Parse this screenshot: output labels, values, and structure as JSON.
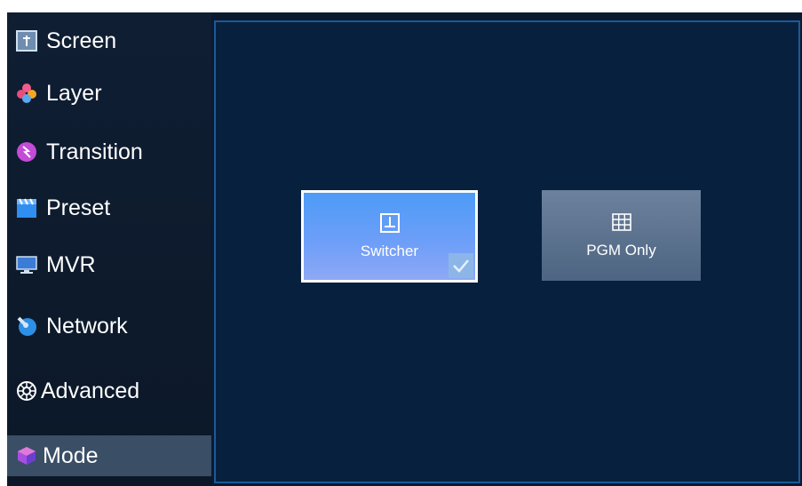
{
  "sidebar": {
    "items": [
      {
        "label": "Screen",
        "icon": "screen-icon"
      },
      {
        "label": "Layer",
        "icon": "layer-icon"
      },
      {
        "label": "Transition",
        "icon": "transition-icon"
      },
      {
        "label": "Preset",
        "icon": "preset-icon"
      },
      {
        "label": "MVR",
        "icon": "mvr-icon"
      },
      {
        "label": "Network",
        "icon": "network-icon"
      },
      {
        "label": "Advanced",
        "icon": "gear-icon"
      },
      {
        "label": "Mode",
        "icon": "mode-icon",
        "active": true
      }
    ]
  },
  "main": {
    "modes": [
      {
        "label": "Switcher",
        "icon": "switcher-icon",
        "selected": true
      },
      {
        "label": "PGM Only",
        "icon": "grid-icon",
        "selected": false
      }
    ]
  },
  "colors": {
    "background": "#0b1a2e",
    "panel": "#07203d",
    "panel_border": "#1a5a9a",
    "active_nav": "#3a4e66",
    "selected_mode": "#5a9cf6"
  }
}
